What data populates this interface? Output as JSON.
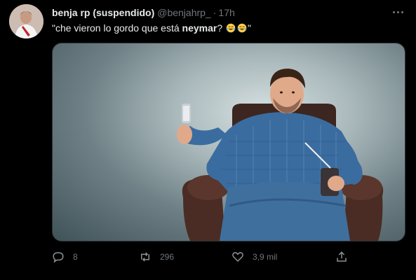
{
  "tweet": {
    "display_name": "benja rp (suspendido)",
    "handle": "@benjahrp_",
    "separator": "·",
    "time": "17h",
    "text_before": "\"che vieron lo gordo que está ",
    "text_bold": "neymar",
    "text_after": "?",
    "text_end": "\"",
    "emoji": [
      "face-with-tears-of-joy",
      "face-with-tears-of-joy"
    ]
  },
  "actions": {
    "reply_count": "8",
    "retweet_count": "296",
    "like_count": "3,9 mil"
  },
  "icons": {
    "more": "more-horizontal-icon",
    "reply": "reply-icon",
    "retweet": "retweet-icon",
    "like": "heart-icon",
    "share": "share-icon"
  },
  "colors": {
    "background": "#000000",
    "text": "#e7e9ea",
    "secondary": "#71767b"
  }
}
